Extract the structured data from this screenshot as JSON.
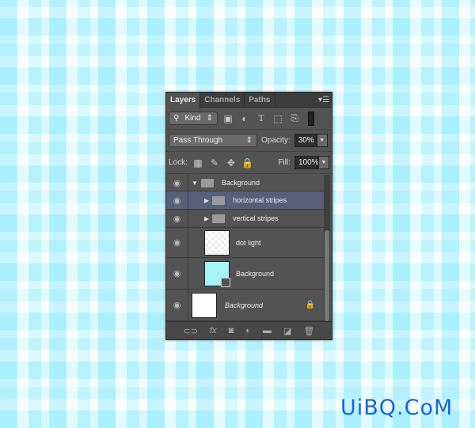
{
  "panel": {
    "tabs": [
      "Layers",
      "Channels",
      "Paths"
    ],
    "filter": "Kind",
    "blend_mode": "Pass Through",
    "opacity_label": "Opacity:",
    "opacity": "30%",
    "lock_label": "Lock:",
    "fill_label": "Fill:",
    "fill": "100%"
  },
  "layers": [
    {
      "name": "Background",
      "type": "group",
      "expanded": true
    },
    {
      "name": "horizontal stripes",
      "type": "group",
      "selected": true
    },
    {
      "name": "vertical stripes",
      "type": "group"
    },
    {
      "name": "dot light",
      "type": "layer"
    },
    {
      "name": "Background",
      "type": "shape",
      "color": "#a6f4f8"
    },
    {
      "name": "Background",
      "type": "background",
      "locked": true
    }
  ],
  "watermark": "UiBQ.CoM"
}
